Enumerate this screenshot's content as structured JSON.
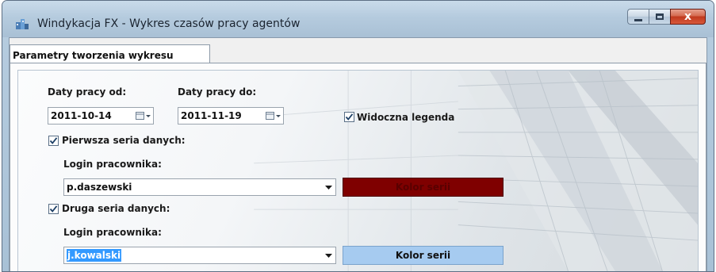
{
  "window": {
    "title": "Windykacja FX - Wykres czasów pracy agentów",
    "close_glyph": "x"
  },
  "tabs": [
    {
      "label": "Parametry tworzenia wykresu",
      "selected": true
    }
  ],
  "form": {
    "date_from": {
      "label": "Daty pracy od:",
      "value": "2011-10-14"
    },
    "date_to": {
      "label": "Daty pracy do:",
      "value": "2011-11-19"
    },
    "legend": {
      "label": "Widoczna legenda",
      "checked": true
    },
    "series1": {
      "label": "Pierwsza seria danych:",
      "checked": true,
      "login_label": "Login pracownika:",
      "login_value": "p.daszewski",
      "color_button_label": "Kolor serii",
      "color": "#7f0000"
    },
    "series2": {
      "label": "Druga seria danych:",
      "checked": true,
      "login_label": "Login pracownika:",
      "login_value": "j.kowalski",
      "color_button_label": "Kolor serii",
      "color": "#a6cbf0"
    }
  }
}
